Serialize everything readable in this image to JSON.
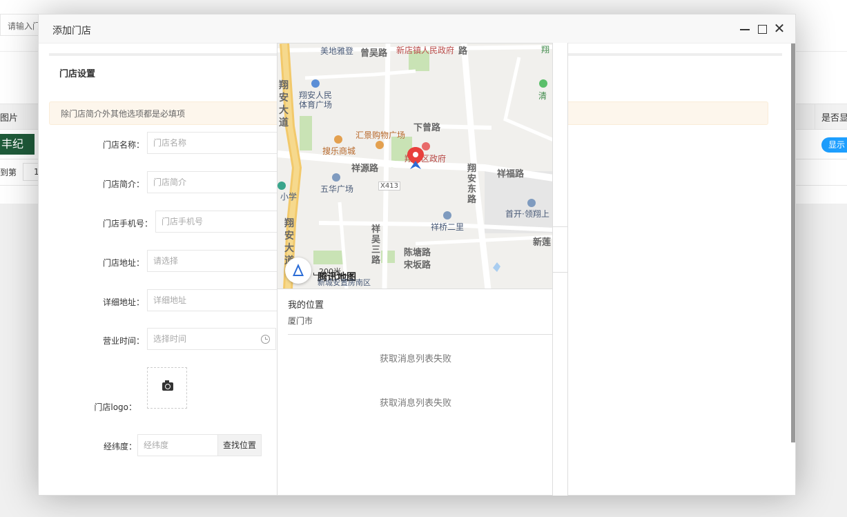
{
  "background": {
    "search_placeholder": "请输入门店",
    "table_header_left": "图片",
    "table_header_right": "是否显",
    "logo_text": "丰纪",
    "show_button": "显示",
    "pager_text": "到第",
    "pager_value": "1"
  },
  "dialog": {
    "title": "添加门店",
    "section_title": "门店设置",
    "tip": "除门店简介外其他选项都是必填项",
    "fields": {
      "name": {
        "label": "门店名称：",
        "placeholder": "门店名称"
      },
      "intro": {
        "label": "门店简介：",
        "placeholder": "门店简介"
      },
      "phone": {
        "label": "门店手机号：",
        "placeholder": "门店手机号"
      },
      "address": {
        "label": "门店地址：",
        "placeholder": "请选择"
      },
      "detail_address": {
        "label": "详细地址：",
        "placeholder": "详细地址"
      },
      "hours": {
        "label": "营业时间：",
        "placeholder": "选择时间"
      },
      "logo": {
        "label": "门店logo："
      },
      "coords": {
        "label": "经纬度：",
        "placeholder": "经纬度",
        "button": "查找位置"
      }
    }
  },
  "map": {
    "labels": {
      "meidi": "美地雅登",
      "zengcuo": "曾吴路",
      "gov_new": "新店镇人民政府",
      "road_top": "路",
      "xiang_an_dadao": "翔安大道",
      "stadium1": "翔安人民",
      "stadium2": "体育广场",
      "xiazeng": "下曾路",
      "huijing": "汇景购物广场",
      "soule": "搜乐商城",
      "district_gov": "翔安区政府",
      "xiangyuan": "祥源路",
      "xiangan_east": "翔安东路",
      "xiangfu": "祥福路",
      "wuhua": "五华广场",
      "x413": "X413",
      "school": "小学",
      "shoukai": "首开·领翔上",
      "xianglian": "新莲",
      "xiangwu3": "祥吴三路",
      "xiangqiao2": "祥桥二里",
      "chentang": "陈塘路",
      "songban": "宋坂路",
      "xiangan_dadao2": "翔安大道",
      "scale": "200米",
      "brand": "腾讯地图",
      "bottom": "新城安置房南区",
      "qingxin": "清",
      "xiang_tr": "翔"
    },
    "my_location": "我的位置",
    "city": "厦门市",
    "fail_messages": [
      "获取消息列表失败",
      "获取消息列表失败"
    ]
  }
}
